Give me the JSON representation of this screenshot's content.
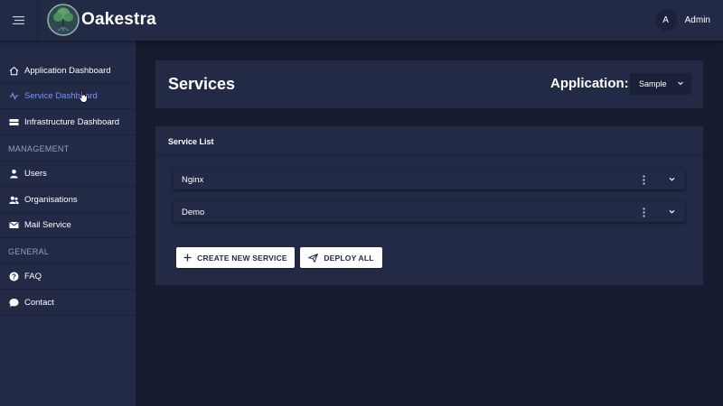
{
  "app": {
    "brand": "Oakestra"
  },
  "user": {
    "initial": "A",
    "name": "Admin"
  },
  "sidebar": {
    "items": [
      {
        "label": "Application Dashboard",
        "icon": "home-icon"
      },
      {
        "label": "Service Dashboard",
        "icon": "activity-icon",
        "active": true
      },
      {
        "label": "Infrastructure Dashboard",
        "icon": "server-icon"
      }
    ],
    "management_heading": "MANAGEMENT",
    "management_items": [
      {
        "label": "Users",
        "icon": "user-icon"
      },
      {
        "label": "Organisations",
        "icon": "group-icon"
      },
      {
        "label": "Mail Service",
        "icon": "mail-icon"
      }
    ],
    "general_heading": "GENERAL",
    "general_items": [
      {
        "label": "FAQ",
        "icon": "help-icon"
      },
      {
        "label": "Contact",
        "icon": "chat-icon"
      }
    ]
  },
  "header": {
    "title": "Services",
    "application_label": "Application:",
    "application_value": "Sample"
  },
  "service_list": {
    "title": "Service List",
    "services": [
      {
        "name": "Nginx"
      },
      {
        "name": "Demo"
      }
    ],
    "create_button": "CREATE NEW SERVICE",
    "deploy_button": "DEPLOY ALL"
  },
  "colors": {
    "background": "#161b30",
    "panel": "#222a45",
    "accent": "#7c92ff",
    "text": "#ffffff",
    "muted": "#9aa1b8"
  }
}
